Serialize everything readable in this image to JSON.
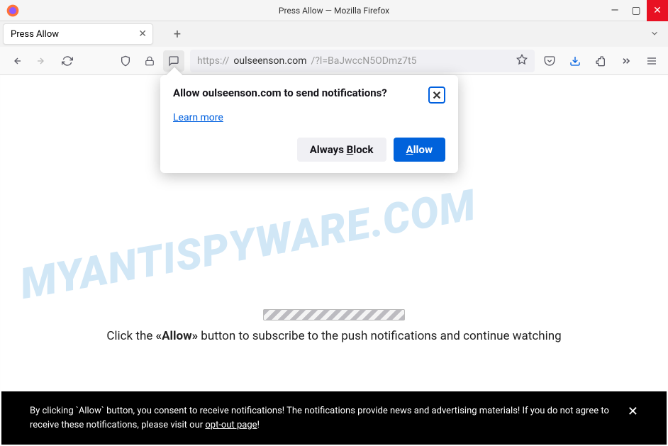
{
  "window": {
    "title": "Press Allow — Mozilla Firefox"
  },
  "tabs": {
    "active": {
      "label": "Press Allow"
    }
  },
  "urlbar": {
    "protocol": "https://",
    "domain": "oulseenson.com",
    "path": "/?l=BaJwccN5ODmz7t5"
  },
  "notification": {
    "title": "Allow oulseenson.com to send notifications?",
    "learn_more": "Learn more",
    "block_label_pre": "Always ",
    "block_label_u": "B",
    "block_label_post": "lock",
    "allow_label_u": "A",
    "allow_label_post": "llow"
  },
  "page": {
    "text_pre": "Click the ",
    "text_bold": "«Allow»",
    "text_post": " button to subscribe to the push notifications and continue watching"
  },
  "consent": {
    "text_pre": "By clicking `Allow` button, you consent to receive notifications! The notifications provide news and advertising materials! If you do not agree to receive these notifications, please visit our ",
    "link": "opt-out page",
    "text_post": "!"
  },
  "watermark": "MYANTISPYWARE.COM"
}
